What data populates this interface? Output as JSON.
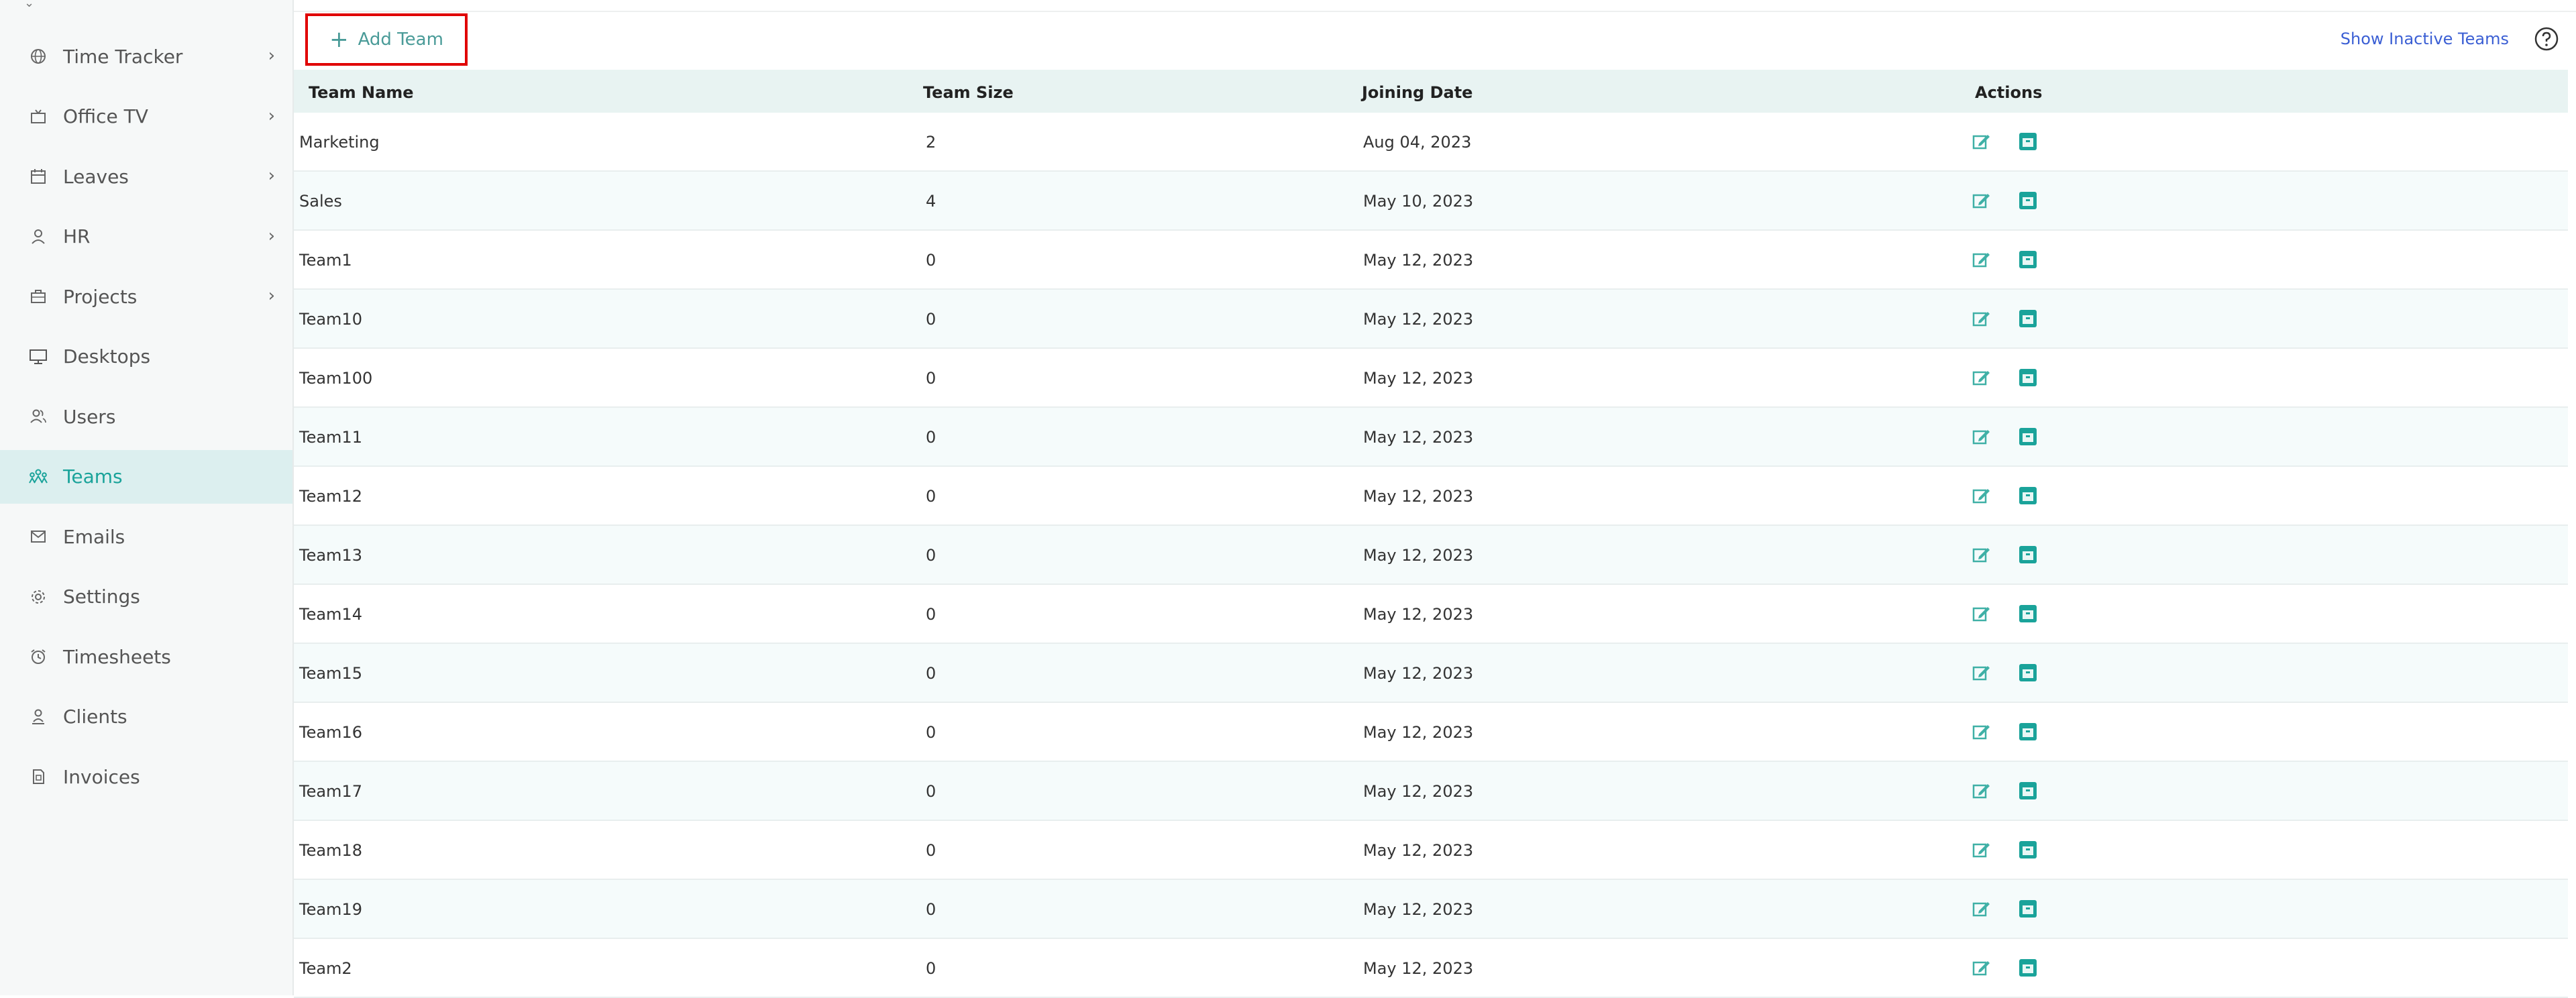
{
  "sidebar": {
    "items": [
      {
        "label": "Time Tracker",
        "icon": "globe-icon",
        "chevron": "›"
      },
      {
        "label": "Office TV",
        "icon": "tv-icon",
        "chevron": "›"
      },
      {
        "label": "Leaves",
        "icon": "calendar-icon",
        "chevron": "›"
      },
      {
        "label": "HR",
        "icon": "person-icon",
        "chevron": "›"
      },
      {
        "label": "Projects",
        "icon": "briefcase-icon",
        "chevron": "›"
      },
      {
        "label": "Desktops",
        "icon": "monitor-icon"
      },
      {
        "label": "Users",
        "icon": "users-icon"
      },
      {
        "label": "Teams",
        "icon": "team-icon",
        "active": true
      },
      {
        "label": "Emails",
        "icon": "mail-icon"
      },
      {
        "label": "Settings",
        "icon": "gear-icon"
      },
      {
        "label": "Timesheets",
        "icon": "alarm-clock-icon"
      },
      {
        "label": "Clients",
        "icon": "client-icon"
      },
      {
        "label": "Invoices",
        "icon": "document-icon"
      }
    ]
  },
  "toolbar": {
    "add_team_label": "Add Team",
    "add_team_plus": "+",
    "show_inactive_label": "Show Inactive Teams"
  },
  "table": {
    "headers": {
      "name": "Team Name",
      "size": "Team Size",
      "date": "Joining Date",
      "actions": "Actions"
    },
    "rows": [
      {
        "name": "Marketing",
        "size": "2",
        "date": "Aug 04, 2023"
      },
      {
        "name": "Sales",
        "size": "4",
        "date": "May 10, 2023"
      },
      {
        "name": "Team1",
        "size": "0",
        "date": "May 12, 2023"
      },
      {
        "name": "Team10",
        "size": "0",
        "date": "May 12, 2023"
      },
      {
        "name": "Team100",
        "size": "0",
        "date": "May 12, 2023"
      },
      {
        "name": "Team11",
        "size": "0",
        "date": "May 12, 2023"
      },
      {
        "name": "Team12",
        "size": "0",
        "date": "May 12, 2023"
      },
      {
        "name": "Team13",
        "size": "0",
        "date": "May 12, 2023"
      },
      {
        "name": "Team14",
        "size": "0",
        "date": "May 12, 2023"
      },
      {
        "name": "Team15",
        "size": "0",
        "date": "May 12, 2023"
      },
      {
        "name": "Team16",
        "size": "0",
        "date": "May 12, 2023"
      },
      {
        "name": "Team17",
        "size": "0",
        "date": "May 12, 2023"
      },
      {
        "name": "Team18",
        "size": "0",
        "date": "May 12, 2023"
      },
      {
        "name": "Team19",
        "size": "0",
        "date": "May 12, 2023"
      },
      {
        "name": "Team2",
        "size": "0",
        "date": "May 12, 2023"
      }
    ]
  },
  "colors": {
    "accent": "#1aa39a",
    "link": "#3b5fd4",
    "highlight_border": "#e00000"
  }
}
